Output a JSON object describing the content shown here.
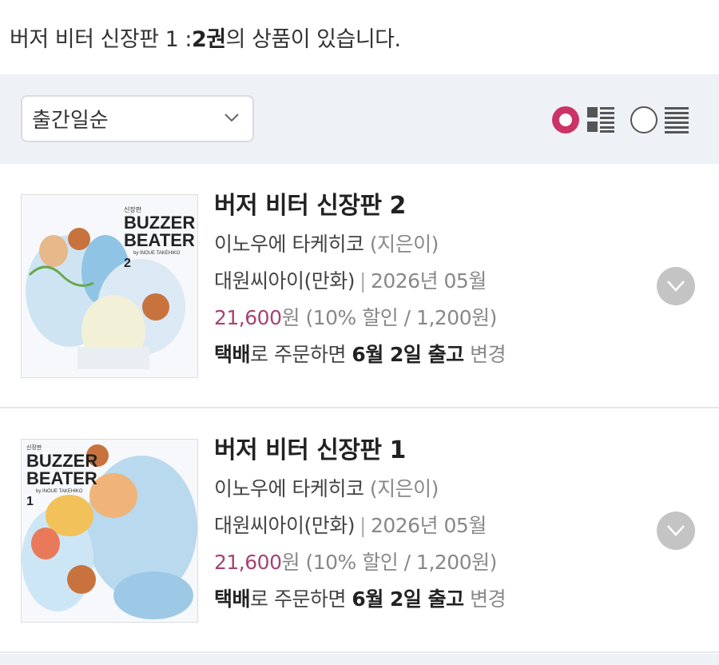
{
  "summary": {
    "prefix": "버저 비터 신장판 1 : ",
    "count": "2권",
    "suffix": "의 상품이 있습니다."
  },
  "toolbar": {
    "sort_value": "출간일순",
    "view_modes": [
      "thumbnail-list",
      "text-list"
    ],
    "selected_view": "thumbnail-list",
    "accent_color": "#cc3366"
  },
  "items": [
    {
      "title": "버저 비터 신장판 2",
      "author": "이노우에 타케히코",
      "author_role": "(지은이)",
      "publisher": "대원씨아이(만화)",
      "date": "2026년 05월",
      "price": "21,600",
      "price_unit": "원",
      "discount": "(10% 할인 / 1,200원)",
      "ship_method": "택배",
      "ship_mid": "로 주문하면 ",
      "ship_date": "6월 2일 출고",
      "ship_change": "변경",
      "cover_title_1": "BUZZER",
      "cover_title_2": "BEATER",
      "cover_byline": "by INOUE TAKEHIKO",
      "cover_vol": "2"
    },
    {
      "title": "버저 비터 신장판 1",
      "author": "이노우에 타케히코",
      "author_role": "(지은이)",
      "publisher": "대원씨아이(만화)",
      "date": "2026년 05월",
      "price": "21,600",
      "price_unit": "원",
      "discount": "(10% 할인 / 1,200원)",
      "ship_method": "택배",
      "ship_mid": "로 주문하면 ",
      "ship_date": "6월 2일 출고",
      "ship_change": "변경",
      "cover_title_1": "BUZZER",
      "cover_title_2": "BEATER",
      "cover_byline": "by INOUE TAKEHIKO",
      "cover_vol": "1"
    }
  ],
  "colors": {
    "price": "#a64375",
    "toolbar_bg": "#eef2f7"
  }
}
